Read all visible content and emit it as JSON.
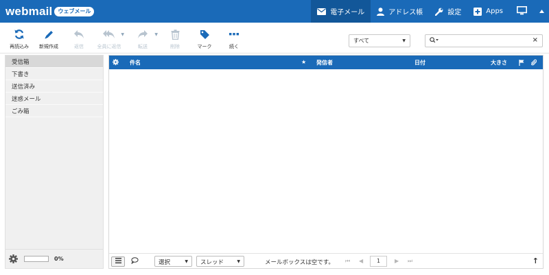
{
  "brand": {
    "logo": "webmail",
    "badge": "ウェブメール"
  },
  "topnav": {
    "items": [
      {
        "label": "電子メール",
        "icon": "envelope-icon",
        "active": true
      },
      {
        "label": "アドレス帳",
        "icon": "user-icon",
        "active": false
      },
      {
        "label": "設定",
        "icon": "wrench-icon",
        "active": false
      },
      {
        "label": "Apps",
        "icon": "plus-square-icon",
        "active": false
      }
    ]
  },
  "toolbar": {
    "refresh": "再読込み",
    "compose": "新規作成",
    "reply": "返信",
    "reply_all": "全員に返信",
    "forward": "転送",
    "delete": "削除",
    "mark": "マーク",
    "more": "続く"
  },
  "filter": {
    "selected": "すべて"
  },
  "search": {
    "value": ""
  },
  "folders": [
    {
      "label": "受信箱",
      "active": true
    },
    {
      "label": "下書き",
      "active": false
    },
    {
      "label": "送信済み",
      "active": false
    },
    {
      "label": "迷惑メール",
      "active": false
    },
    {
      "label": "ごみ箱",
      "active": false
    }
  ],
  "quota": {
    "text": "0%",
    "fraction": 0
  },
  "list_header": {
    "subject": "件名",
    "from": "発信者",
    "date": "日付",
    "size": "大きさ"
  },
  "list_footer": {
    "select": "選択",
    "threads": "スレッド",
    "status": "メールボックスは空です。",
    "page": "1"
  },
  "colors": {
    "accent": "#1a6ab8",
    "accent_dark": "#125799",
    "icon_blue": "#1a6ab8",
    "icon_disabled": "#b8c4cf"
  }
}
